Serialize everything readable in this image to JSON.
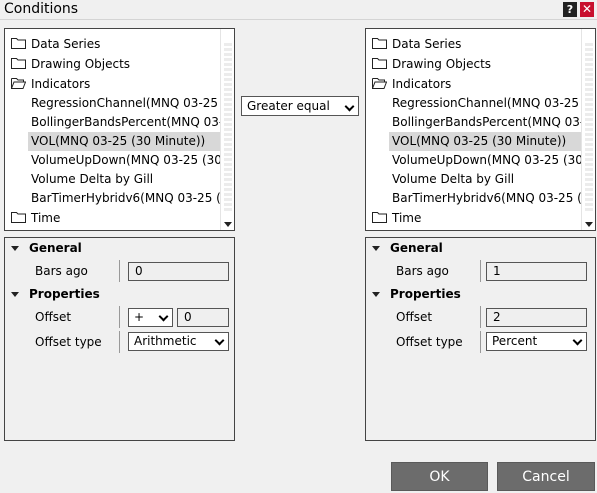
{
  "window": {
    "title": "Conditions",
    "help_label": "?",
    "close_label": "✕"
  },
  "left_tree": {
    "folders": [
      "Data Series",
      "Drawing Objects",
      "Indicators"
    ],
    "indicators": [
      "RegressionChannel(MNQ 03-25 (…",
      "BollingerBandsPercent(MNQ 03-2…",
      "VOL(MNQ 03-25 (30 Minute))",
      "VolumeUpDown(MNQ 03-25 (30…",
      "Volume Delta by Gill",
      "BarTimerHybridv6(MNQ 03-25 (3…"
    ],
    "selected_index": 2,
    "last_folder": "Time"
  },
  "right_tree": {
    "folders": [
      "Data Series",
      "Drawing Objects",
      "Indicators"
    ],
    "indicators": [
      "RegressionChannel(MNQ 03-25 (…",
      "BollingerBandsPercent(MNQ 03-2…",
      "VOL(MNQ 03-25 (30 Minute))",
      "VolumeUpDown(MNQ 03-25 (30…",
      "Volume Delta by Gill",
      "BarTimerHybridv6(MNQ 03-25 (3…"
    ],
    "selected_index": 2,
    "last_folder": "Time"
  },
  "operator": {
    "selected": "Greater equal"
  },
  "left_props": {
    "general_label": "General",
    "bars_ago_label": "Bars ago",
    "bars_ago_value": "0",
    "properties_label": "Properties",
    "offset_label": "Offset",
    "offset_sign": "+",
    "offset_value": "0",
    "offset_type_label": "Offset type",
    "offset_type_value": "Arithmetic"
  },
  "right_props": {
    "general_label": "General",
    "bars_ago_label": "Bars ago",
    "bars_ago_value": "1",
    "properties_label": "Properties",
    "offset_label": "Offset",
    "offset_value": "2",
    "offset_type_label": "Offset type",
    "offset_type_value": "Percent"
  },
  "buttons": {
    "ok": "OK",
    "cancel": "Cancel"
  },
  "colors": {
    "button_bg": "#6c6c6c",
    "close_bg": "#c8102e",
    "selection": "#d8d8d8"
  }
}
